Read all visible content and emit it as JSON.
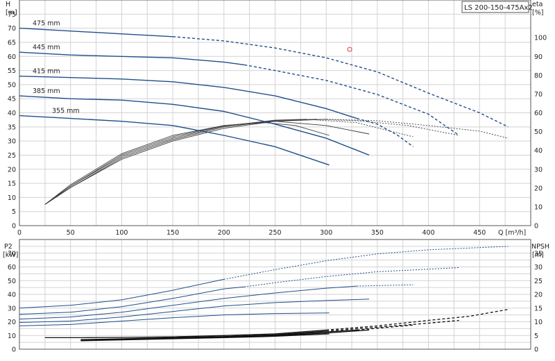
{
  "title_badge": "LS 200-150-475Ax2",
  "colors": {
    "blue": "#1f4e8c",
    "dark": "#3a3a3a",
    "grey": "#7a7a7a",
    "grid": "#d2d2d2",
    "axis": "#555555",
    "marker": "#e03a3a"
  },
  "chart_data": [
    {
      "type": "line",
      "name": "head-efficiency",
      "x_axis": {
        "label": "Q [m³/h]",
        "min": 0,
        "max": 500,
        "ticks": [
          0,
          50,
          100,
          150,
          200,
          250,
          300,
          350,
          400,
          450
        ]
      },
      "y_axis_left": {
        "label_top": "H",
        "label_unit": "[m]",
        "min": 0,
        "max": 80,
        "ticks": [
          0,
          5,
          10,
          15,
          20,
          25,
          30,
          35,
          40,
          45,
          50,
          55,
          60,
          65,
          70,
          75
        ]
      },
      "y_axis_right": {
        "label_top": "eta",
        "label_unit": "[%]",
        "min": 0,
        "max": 120,
        "ticks": [
          0,
          10,
          20,
          30,
          40,
          50,
          60,
          70,
          80,
          90,
          100
        ]
      },
      "grid": true,
      "marker": {
        "q": 323,
        "h": 62.5
      },
      "head_curves": [
        {
          "label": "475 mm",
          "solid": [
            [
              0,
              70.0
            ],
            [
              50,
              69.0
            ],
            [
              100,
              68.0
            ],
            [
              150,
              67.0
            ]
          ],
          "dashed": [
            [
              150,
              67.0
            ],
            [
              200,
              65.5
            ],
            [
              250,
              63.0
            ],
            [
              300,
              59.5
            ],
            [
              350,
              54.5
            ],
            [
              400,
              47.0
            ],
            [
              450,
              40.0
            ],
            [
              478,
              35.0
            ]
          ]
        },
        {
          "label": "445 mm",
          "solid": [
            [
              0,
              61.5
            ],
            [
              50,
              60.5
            ],
            [
              100,
              60.0
            ],
            [
              150,
              59.5
            ],
            [
              200,
              58.0
            ],
            [
              220,
              57.0
            ]
          ],
          "dashed": [
            [
              220,
              57.0
            ],
            [
              250,
              55.0
            ],
            [
              300,
              51.5
            ],
            [
              350,
              46.5
            ],
            [
              400,
              39.5
            ],
            [
              430,
              32.0
            ]
          ]
        },
        {
          "label": "415 mm",
          "solid": [
            [
              0,
              53.0
            ],
            [
              50,
              52.5
            ],
            [
              100,
              52.0
            ],
            [
              150,
              51.0
            ],
            [
              200,
              49.0
            ],
            [
              250,
              46.0
            ],
            [
              300,
              41.5
            ],
            [
              330,
              38.0
            ]
          ],
          "dashed": [
            [
              330,
              38.0
            ],
            [
              350,
              36.0
            ],
            [
              370,
              32.0
            ],
            [
              385,
              28.0
            ]
          ]
        },
        {
          "label": "385 mm",
          "solid": [
            [
              0,
              46.0
            ],
            [
              50,
              45.0
            ],
            [
              100,
              44.5
            ],
            [
              150,
              43.0
            ],
            [
              200,
              40.5
            ],
            [
              250,
              36.0
            ],
            [
              300,
              31.0
            ],
            [
              342,
              25.0
            ]
          ],
          "dashed": []
        },
        {
          "label": "355 mm",
          "solid": [
            [
              0,
              39.0
            ],
            [
              50,
              38.0
            ],
            [
              100,
              37.0
            ],
            [
              150,
              35.5
            ],
            [
              200,
              32.0
            ],
            [
              250,
              28.0
            ],
            [
              303,
              21.5
            ]
          ],
          "dashed": []
        }
      ],
      "efficiency_curves": [
        {
          "solid": [
            [
              25,
              7.5
            ],
            [
              50,
              13.5
            ],
            [
              100,
              23.5
            ],
            [
              150,
              30.0
            ],
            [
              200,
              34.5
            ],
            [
              250,
              37.0
            ],
            [
              300,
              37.7
            ]
          ],
          "dashed": [
            [
              300,
              37.7
            ],
            [
              350,
              37.2
            ],
            [
              400,
              35.5
            ],
            [
              450,
              33.5
            ],
            [
              478,
              31.0
            ]
          ]
        },
        {
          "solid": [
            [
              25,
              7.5
            ],
            [
              50,
              13.5
            ],
            [
              100,
              24.0
            ],
            [
              150,
              30.5
            ],
            [
              200,
              35.0
            ],
            [
              250,
              37.2
            ],
            [
              290,
              37.7
            ]
          ],
          "dashed": [
            [
              290,
              37.7
            ],
            [
              330,
              37.2
            ],
            [
              380,
              35.5
            ],
            [
              430,
              32.0
            ]
          ]
        },
        {
          "solid": [
            [
              25,
              7.5
            ],
            [
              50,
              14.0
            ],
            [
              100,
              24.5
            ],
            [
              150,
              31.0
            ],
            [
              200,
              35.3
            ],
            [
              250,
              37.4
            ],
            [
              280,
              37.7
            ]
          ],
          "dashed": [
            [
              280,
              37.7
            ],
            [
              330,
              36.5
            ],
            [
              385,
              31.5
            ]
          ]
        },
        {
          "solid": [
            [
              25,
              7.5
            ],
            [
              50,
              14.0
            ],
            [
              100,
              25.0
            ],
            [
              150,
              31.5
            ],
            [
              200,
              35.5
            ],
            [
              250,
              37.0
            ],
            [
              300,
              35.5
            ],
            [
              342,
              32.5
            ]
          ],
          "dashed": []
        },
        {
          "solid": [
            [
              25,
              7.5
            ],
            [
              50,
              14.5
            ],
            [
              100,
              25.5
            ],
            [
              150,
              32.0
            ],
            [
              200,
              35.5
            ],
            [
              240,
              36.5
            ],
            [
              270,
              35.5
            ],
            [
              303,
              32.0
            ]
          ],
          "dashed": []
        }
      ]
    },
    {
      "type": "line",
      "name": "power-npsh",
      "x_axis": {
        "min": 0,
        "max": 500
      },
      "y_axis_left": {
        "label_top": "P2",
        "label_unit": "[kW]",
        "min": 0,
        "max": 80,
        "ticks": [
          0,
          10,
          20,
          30,
          40,
          50,
          60,
          70
        ]
      },
      "y_axis_right": {
        "label_top": "NPSH",
        "label_unit": "[m]",
        "min": 0,
        "max": 40,
        "ticks": [
          0,
          5,
          10,
          15,
          20,
          25,
          30,
          35
        ]
      },
      "grid": true,
      "power_curves": [
        {
          "solid": [
            [
              0,
              30.0
            ],
            [
              50,
              32.0
            ],
            [
              100,
              36.0
            ],
            [
              150,
              43.0
            ],
            [
              200,
              51.0
            ]
          ],
          "dashed": [
            [
              200,
              51.0
            ],
            [
              250,
              58.0
            ],
            [
              300,
              64.5
            ],
            [
              350,
              69.5
            ],
            [
              400,
              72.5
            ],
            [
              478,
              75.0
            ]
          ]
        },
        {
          "solid": [
            [
              0,
              25.5
            ],
            [
              50,
              27.0
            ],
            [
              100,
              31.0
            ],
            [
              150,
              37.0
            ],
            [
              200,
              44.0
            ],
            [
              220,
              45.5
            ]
          ],
          "dashed": [
            [
              220,
              45.5
            ],
            [
              250,
              48.5
            ],
            [
              300,
              53.0
            ],
            [
              350,
              56.5
            ],
            [
              430,
              59.5
            ]
          ]
        },
        {
          "solid": [
            [
              0,
              22.0
            ],
            [
              50,
              23.5
            ],
            [
              100,
              27.0
            ],
            [
              150,
              32.0
            ],
            [
              200,
              37.0
            ],
            [
              250,
              41.0
            ],
            [
              300,
              44.5
            ],
            [
              330,
              46.0
            ]
          ],
          "dashed": [
            [
              330,
              46.0
            ],
            [
              385,
              47.0
            ]
          ]
        },
        {
          "solid": [
            [
              0,
              19.5
            ],
            [
              50,
              20.5
            ],
            [
              100,
              23.5
            ],
            [
              150,
              27.5
            ],
            [
              200,
              31.5
            ],
            [
              250,
              34.0
            ],
            [
              300,
              35.5
            ],
            [
              342,
              36.5
            ]
          ],
          "dashed": []
        },
        {
          "solid": [
            [
              0,
              17.0
            ],
            [
              50,
              18.0
            ],
            [
              100,
              20.5
            ],
            [
              150,
              23.0
            ],
            [
              200,
              25.0
            ],
            [
              250,
              26.0
            ],
            [
              303,
              26.5
            ]
          ],
          "dashed": []
        }
      ],
      "npsh_curves": [
        {
          "solid": [
            [
              25,
              4.2
            ],
            [
              60,
              4.2
            ],
            [
              100,
              4.3
            ],
            [
              150,
              4.5
            ],
            [
              200,
              5.0
            ],
            [
              250,
              5.6
            ],
            [
              300,
              7.0
            ]
          ],
          "dashed": [
            [
              300,
              7.0
            ],
            [
              350,
              8.5
            ],
            [
              400,
              10.5
            ],
            [
              440,
              12.0
            ],
            [
              478,
              14.5
            ]
          ]
        },
        {
          "solid": [
            [
              60,
              3.5
            ],
            [
              100,
              3.8
            ],
            [
              150,
              4.2
            ],
            [
              200,
              4.6
            ],
            [
              250,
              5.3
            ],
            [
              300,
              6.6
            ]
          ],
          "dashed": [
            [
              300,
              6.6
            ],
            [
              350,
              8.0
            ],
            [
              400,
              9.5
            ],
            [
              430,
              10.5
            ]
          ]
        },
        {
          "solid": [
            [
              60,
              3.3
            ],
            [
              100,
              3.6
            ],
            [
              150,
              4.0
            ],
            [
              200,
              4.4
            ],
            [
              250,
              5.1
            ],
            [
              300,
              6.3
            ],
            [
              330,
              7.0
            ]
          ],
          "dashed": [
            [
              330,
              7.0
            ],
            [
              385,
              8.8
            ]
          ]
        },
        {
          "solid": [
            [
              60,
              3.2
            ],
            [
              100,
              3.5
            ],
            [
              150,
              3.9
            ],
            [
              200,
              4.3
            ],
            [
              250,
              4.9
            ],
            [
              300,
              5.9
            ],
            [
              342,
              7.0
            ]
          ],
          "dashed": []
        },
        {
          "solid": [
            [
              60,
              3.1
            ],
            [
              100,
              3.4
            ],
            [
              150,
              3.8
            ],
            [
              200,
              4.2
            ],
            [
              250,
              4.7
            ],
            [
              303,
              5.6
            ]
          ],
          "dashed": []
        }
      ]
    }
  ]
}
